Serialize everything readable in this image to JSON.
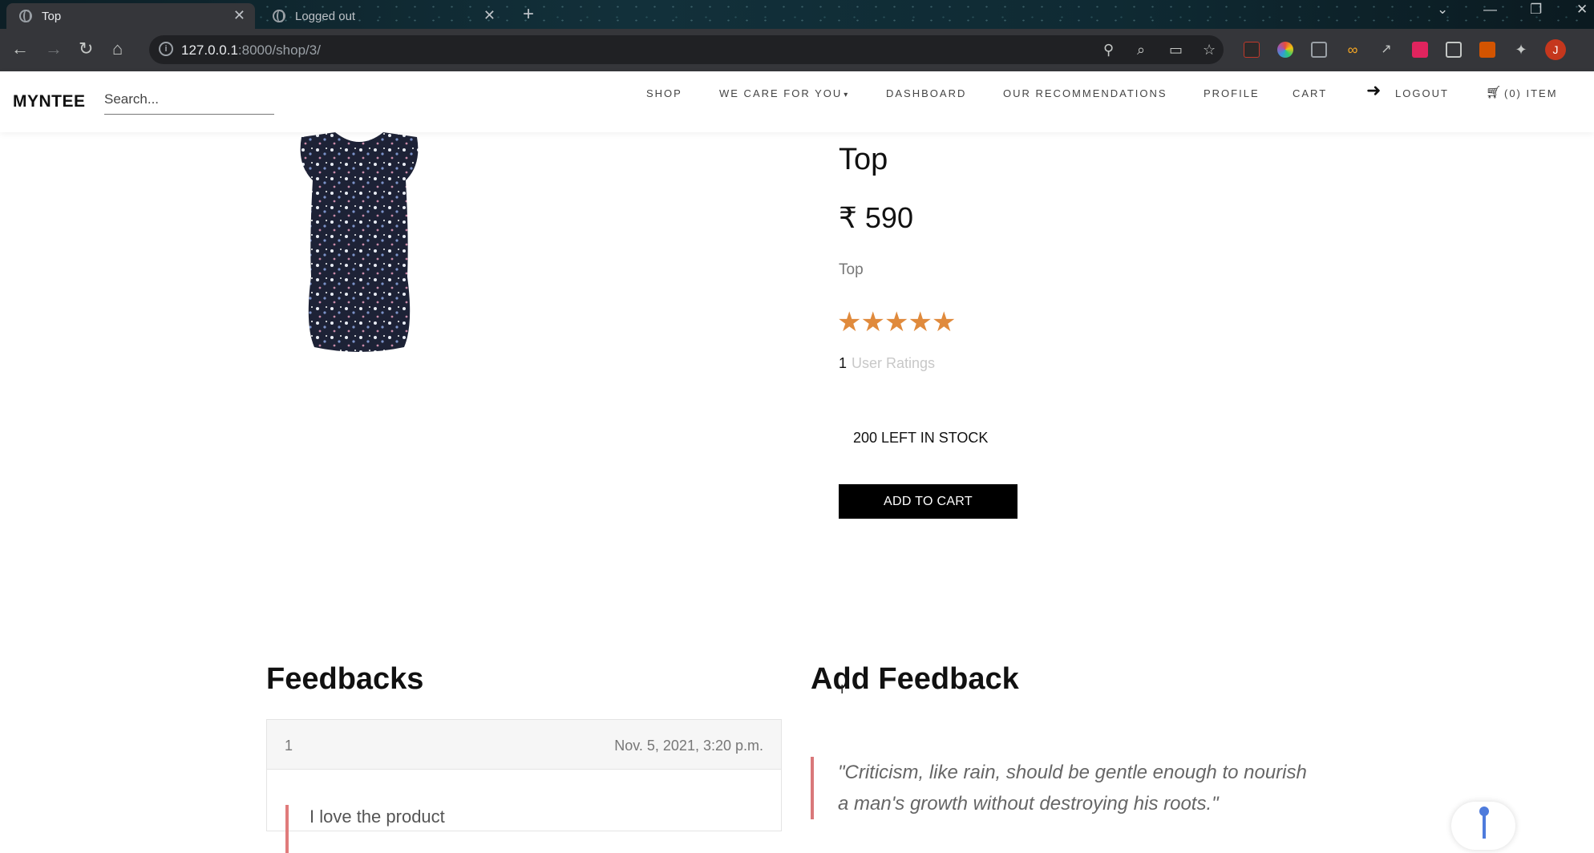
{
  "browser": {
    "tabs": [
      {
        "title": "Top",
        "active": true
      },
      {
        "title": "Logged out",
        "active": false
      }
    ],
    "url_host": "127.0.0.1",
    "url_rest": ":8000/shop/3/",
    "profile_initial": "J"
  },
  "site": {
    "brand": "MYNTEE",
    "search_placeholder": "Search...",
    "nav": {
      "shop": "SHOP",
      "care": "WE CARE FOR YOU",
      "dashboard": "DASHBOARD",
      "recommendations": "OUR RECOMMENDATIONS",
      "profile": "PROFILE",
      "cart": "CART",
      "logout": "LOGOUT",
      "cart_items": "(0) ITEM"
    }
  },
  "product": {
    "title": "Top",
    "price": "₹ 590",
    "description": "Top",
    "rating": 5,
    "rating_count": "1",
    "rating_label": "User Ratings",
    "stock": "200 LEFT IN STOCK",
    "add_to_cart": "ADD TO CART"
  },
  "feedback": {
    "heading": "Feedbacks",
    "items": [
      {
        "user": "1",
        "date": "Nov. 5, 2021, 3:20 p.m.",
        "text": "I love the product"
      }
    ]
  },
  "add_feedback": {
    "heading": "Add Feedback",
    "quote": "\"Criticism, like rain, should be gentle enough to nourish a man's growth without destroying his roots.\""
  },
  "colors": {
    "star": "#e08a3c",
    "quote_border": "#d9787a",
    "button_bg": "#000000"
  }
}
